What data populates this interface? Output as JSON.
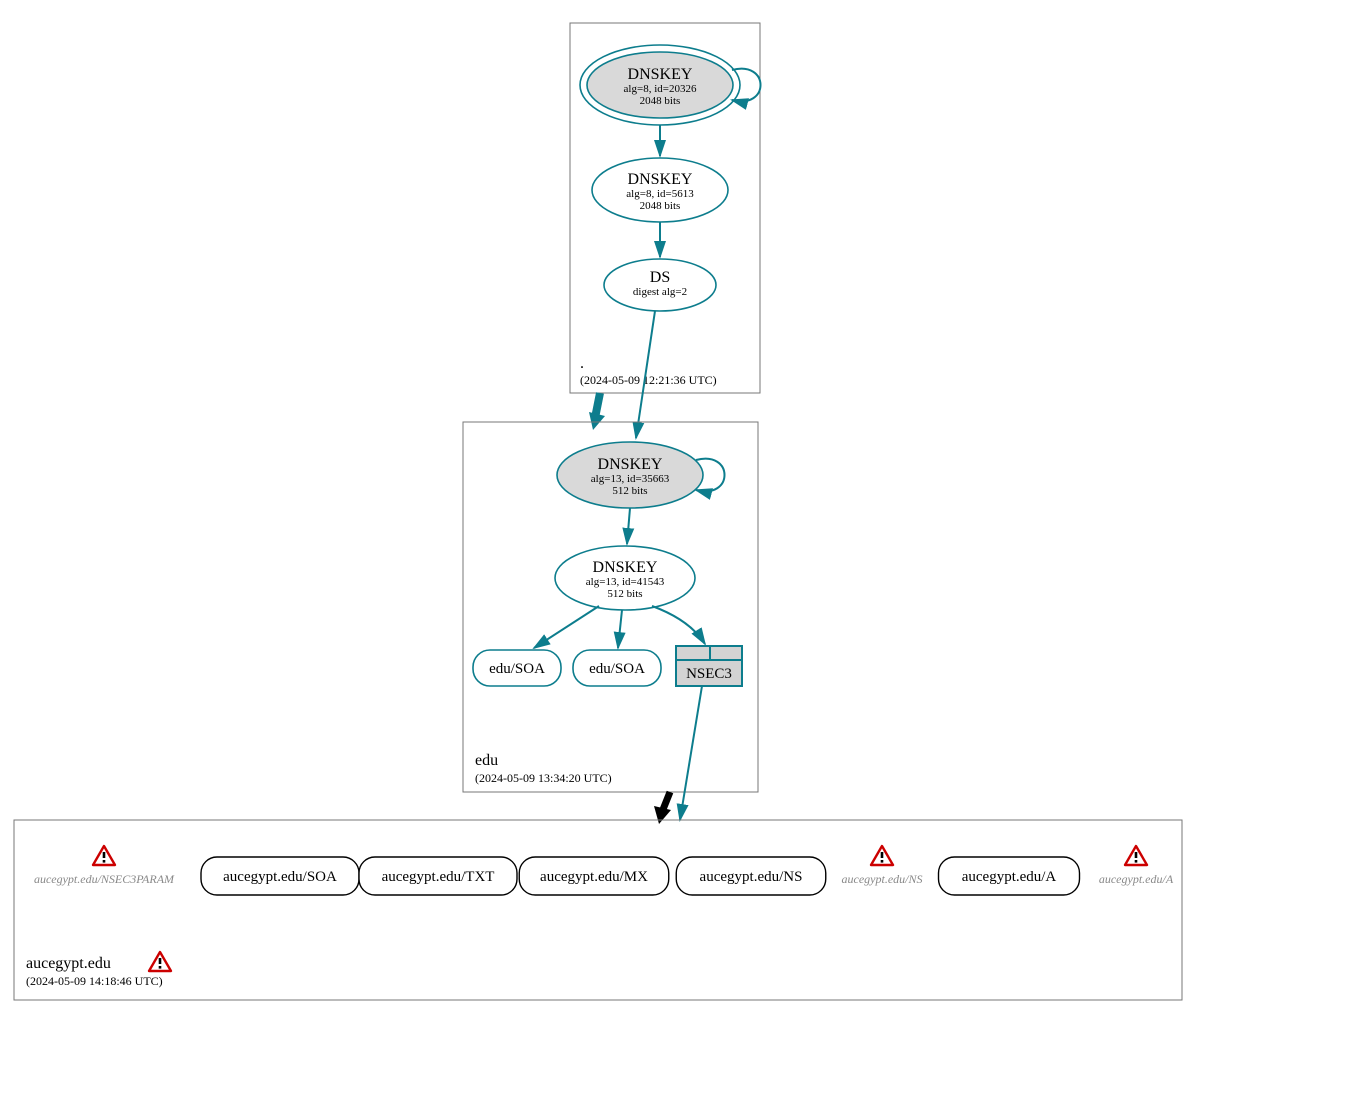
{
  "zones": {
    "root": {
      "label": ".",
      "timestamp": "(2024-05-09 12:21:36 UTC)",
      "ksk": {
        "title": "DNSKEY",
        "line1": "alg=8, id=20326",
        "line2": "2048 bits"
      },
      "zsk": {
        "title": "DNSKEY",
        "line1": "alg=8, id=5613",
        "line2": "2048 bits"
      },
      "ds": {
        "title": "DS",
        "line1": "digest alg=2"
      }
    },
    "edu": {
      "label": "edu",
      "timestamp": "(2024-05-09 13:34:20 UTC)",
      "ksk": {
        "title": "DNSKEY",
        "line1": "alg=13, id=35663",
        "line2": "512 bits"
      },
      "zsk": {
        "title": "DNSKEY",
        "line1": "alg=13, id=41543",
        "line2": "512 bits"
      },
      "soa1": {
        "label": "edu/SOA"
      },
      "soa2": {
        "label": "edu/SOA"
      },
      "nsec3": {
        "label": "NSEC3"
      }
    },
    "auc": {
      "label": "aucegypt.edu",
      "timestamp": "(2024-05-09 14:18:46 UTC)",
      "rrsets": [
        {
          "label": "aucegypt.edu/NSEC3PARAM",
          "warn": true,
          "grey": true
        },
        {
          "label": "aucegypt.edu/SOA",
          "warn": false,
          "grey": false
        },
        {
          "label": "aucegypt.edu/TXT",
          "warn": false,
          "grey": false
        },
        {
          "label": "aucegypt.edu/MX",
          "warn": false,
          "grey": false
        },
        {
          "label": "aucegypt.edu/NS",
          "warn": false,
          "grey": false
        },
        {
          "label": "aucegypt.edu/NS",
          "warn": true,
          "grey": true
        },
        {
          "label": "aucegypt.edu/A",
          "warn": false,
          "grey": false
        },
        {
          "label": "aucegypt.edu/A",
          "warn": true,
          "grey": true
        }
      ],
      "zone_warn": true
    }
  }
}
